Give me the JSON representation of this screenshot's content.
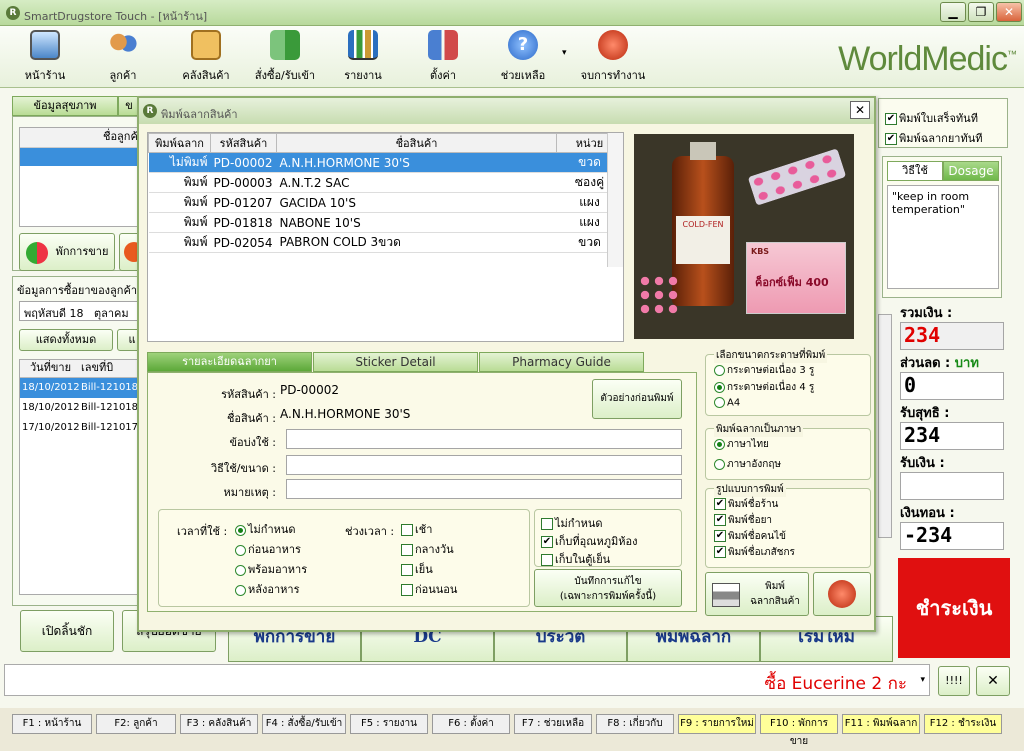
{
  "app": {
    "title": "SmartDrugstore Touch - [หน้าร้าน]",
    "brand": "WorldMedic",
    "brand_tm": "™"
  },
  "window": {
    "min": "▁",
    "restore": "❐",
    "close": "✕"
  },
  "toolbar": [
    {
      "label": "หน้าร้าน",
      "icon": "monitor-icon"
    },
    {
      "label": "ลูกค้า",
      "icon": "users-icon"
    },
    {
      "label": "คลังสินค้า",
      "icon": "search-box-icon"
    },
    {
      "label": "สั่งซื้อ/รับเข้า",
      "icon": "refresh-icon"
    },
    {
      "label": "รายงาน",
      "icon": "chart-icon"
    },
    {
      "label": "ตั้งค่า",
      "icon": "tools-icon"
    },
    {
      "label": "ช่วยเหลือ",
      "icon": "help-icon"
    },
    {
      "label": "จบการทำงาน",
      "icon": "power-icon"
    }
  ],
  "left": {
    "tab1": "ข้อมูลสุขภาพ",
    "tab2": "ข",
    "cust_col": "ชื่อลูกค้า",
    "btn_pause": "พักการขาย",
    "btn_paused": "",
    "purchase_label": "ข้อมูลการซื้อยาของลูกค้า",
    "date_day": "พฤหัสบดี 18",
    "date_month": "ตุลาคม",
    "show_all": "แสดงทั้งหมด",
    "show2": "แ",
    "hist_cols": [
      "วันที่ขาย",
      "เลขที่บิ"
    ],
    "hist_rows": [
      [
        "18/10/2012",
        "Bill-121018-"
      ],
      [
        "18/10/2012",
        "Bill-121018-0"
      ],
      [
        "17/10/2012",
        "Bill-121017-0"
      ]
    ],
    "open_drawer": "เปิดลิ้นชัก",
    "summary": "สรุปยอดขาย"
  },
  "dialog": {
    "title": "พิมพ์ฉลากสินค้า",
    "close": "✕",
    "cols": [
      "พิมพ์ฉลาก",
      "รหัสสินค้า",
      "ชื่อสินค้า",
      "หน่วย"
    ],
    "rows": [
      {
        "print": "ไม่พิมพ์",
        "code": "PD-00002",
        "name": "A.N.H.HORMONE 30'S",
        "unit": "ขวด",
        "sel": true
      },
      {
        "print": "พิมพ์",
        "code": "PD-00003",
        "name": "A.N.T.2 SAC",
        "unit": "ซองคู่"
      },
      {
        "print": "พิมพ์",
        "code": "PD-01207",
        "name": "GACIDA 10'S",
        "unit": "แผง"
      },
      {
        "print": "พิมพ์",
        "code": "PD-01818",
        "name": "NABONE 10'S",
        "unit": "แผง"
      },
      {
        "print": "พิมพ์",
        "code": "PD-02054",
        "name": "PABRON COLD 3ขวด",
        "unit": "ขวด"
      }
    ],
    "image": {
      "bottle_label": "COLD-FEN",
      "box_label": "ค็อกซ์เฟ็ม 400",
      "brand_mark": "KBS"
    },
    "tabs": [
      "รายละเอียดฉลากยา",
      "Sticker Detail",
      "Pharmacy Guide"
    ],
    "code_label": "รหัสสินค้า :",
    "code_val": "PD-00002",
    "name_label": "ชื่อสินค้า :",
    "name_val": "A.N.H.HORMONE 30'S",
    "indication_label": "ข้อบ่งใช้ :",
    "usage_label": "วิธีใช้/ขนาด :",
    "note_label": "หมายเหตุ :",
    "preview_btn": "ตัวอย่างก่อนพิมพ์",
    "time_label": "เวลาที่ใช้ :",
    "period_label": "ช่วงเวลา :",
    "time_opts": [
      {
        "label": "ไม่กำหนด",
        "on": true
      },
      {
        "label": "ก่อนอาหาร"
      },
      {
        "label": "พร้อมอาหาร"
      },
      {
        "label": "หลังอาหาร"
      }
    ],
    "period_opts": [
      "เช้า",
      "กลางวัน",
      "เย็น",
      "ก่อนนอน"
    ],
    "storage_opts": [
      {
        "label": "ไม่กำหนด",
        "on": false
      },
      {
        "label": "เก็บที่อุณหภูมิห้อง",
        "on": true
      },
      {
        "label": "เก็บในตู้เย็น",
        "on": false
      }
    ],
    "save_btn1": "บันทึกการแก้ไข",
    "save_btn2": "(เฉพาะการพิมพ์ครั้งนี้)",
    "paper_title": "เลือกขนาดกระดาษที่พิมพ์",
    "paper_opts": [
      {
        "label": "กระดาษต่อเนื่อง 3 รู",
        "on": false
      },
      {
        "label": "กระดาษต่อเนื่อง 4 รู",
        "on": true
      },
      {
        "label": "A4",
        "on": false
      }
    ],
    "lang_title": "พิมพ์ฉลากเป็นภาษา",
    "lang_opts": [
      {
        "label": "ภาษาไทย",
        "on": true
      },
      {
        "label": "ภาษาอังกฤษ",
        "on": false
      }
    ],
    "format_title": "รูปแบบการพิมพ์",
    "format_opts": [
      "พิมพ์ชื่อร้าน",
      "พิมพ์ชื่อยา",
      "พิมพ์ชื่อคนไข้",
      "พิมพ์ชื่อเภสัชกร"
    ],
    "print_btn1": "พิมพ์",
    "print_btn2": "ฉลากสินค้า"
  },
  "right": {
    "chk1": "พิมพ์ใบเสร็จทันที",
    "chk2": "พิมพ์ฉลากยาทันที",
    "tab_usage": "วิธีใช้",
    "tab_dosage": "Dosage",
    "usage_text": "\"keep in room temperation\"",
    "total_label": "รวมเงิน :",
    "total": "234",
    "disc_label": "ส่วนลด :",
    "disc_unit": "บาท",
    "disc": "0",
    "net_label": "รับสุทธิ :",
    "net": "234",
    "recv_label": "รับเงิน :",
    "recv": "",
    "change_label": "เงินทอน :",
    "change": "-234",
    "pay_btn": "ชำระเงิน"
  },
  "bottom": {
    "btns": [
      "พักการขาย",
      "DC",
      "ประวัติ",
      "พิมพ์ฉลาก",
      "เริ่มใหม่"
    ],
    "ticker": "ซื้อ Eucerine 2 กะ",
    "b1": "!!!!",
    "b2": "✕"
  },
  "fkeys": [
    {
      "t": "F1 : หน้าร้าน"
    },
    {
      "t": "F2: ลูกค้า"
    },
    {
      "t": "F3 : คลังสินค้า"
    },
    {
      "t": "F4 : สั่งซื้อ/รับเข้า"
    },
    {
      "t": "F5 : รายงาน"
    },
    {
      "t": "F6 : ตั้งค่า"
    },
    {
      "t": "F7 : ช่วยเหลือ"
    },
    {
      "t": "F8 : เกี่ยวกับ"
    },
    {
      "t": "F9 : รายการใหม่",
      "y": true
    },
    {
      "t": "F10 : พักการขาย",
      "y": true
    },
    {
      "t": "F11 : พิมพ์ฉลาก",
      "y": true
    },
    {
      "t": "F12 : ชำระเงิน",
      "y": true
    }
  ]
}
